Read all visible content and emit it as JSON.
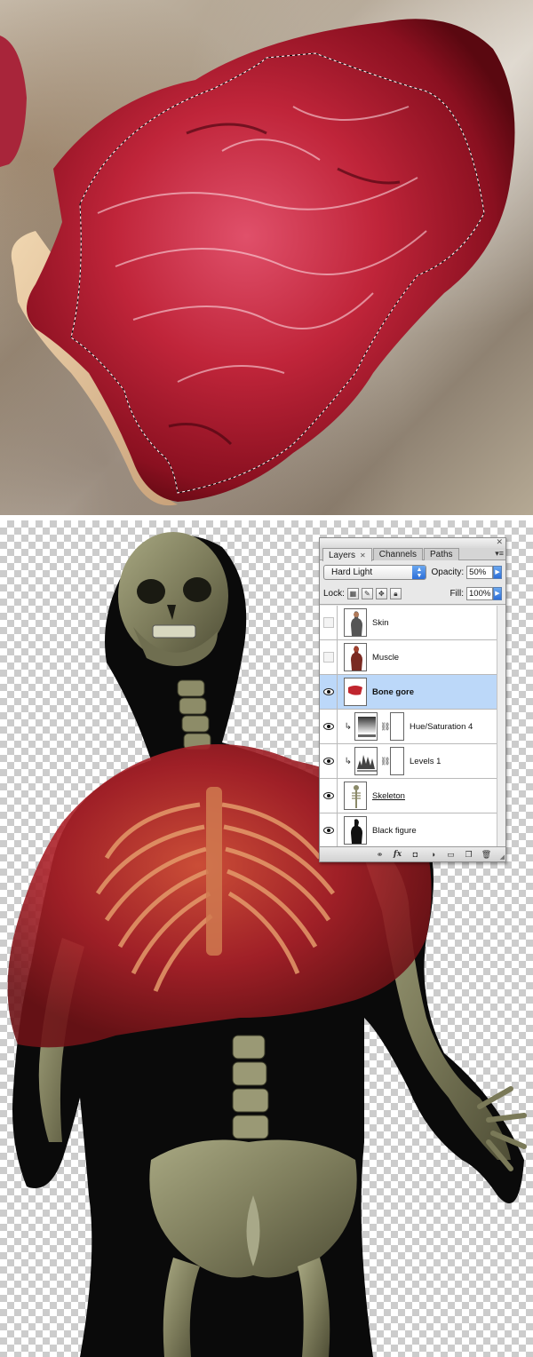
{
  "palette": {
    "tabs": [
      {
        "label": "Layers",
        "active": true
      },
      {
        "label": "Channels",
        "active": false
      },
      {
        "label": "Paths",
        "active": false
      }
    ],
    "blend_mode": "Hard Light",
    "opacity_label": "Opacity:",
    "opacity_value": "50%",
    "lock_label": "Lock:",
    "fill_label": "Fill:",
    "fill_value": "100%",
    "layers": [
      {
        "name": "Skin",
        "visible": false,
        "selected": false,
        "thumb": "figure-skin"
      },
      {
        "name": "Muscle",
        "visible": false,
        "selected": false,
        "thumb": "figure-muscle"
      },
      {
        "name": "Bone gore",
        "visible": true,
        "selected": true,
        "thumb": "figure-gore"
      },
      {
        "name": "Hue/Saturation 4",
        "visible": true,
        "selected": false,
        "type": "adjustment-hue-saturation",
        "clipped": true
      },
      {
        "name": "Levels 1",
        "visible": true,
        "selected": false,
        "type": "adjustment-levels",
        "clipped": true
      },
      {
        "name": "Skeleton",
        "visible": true,
        "selected": false,
        "thumb": "figure-skeleton"
      },
      {
        "name": "Black figure",
        "visible": true,
        "selected": false,
        "thumb": "figure-black"
      }
    ],
    "bottom_buttons": [
      "link-icon",
      "fx-icon",
      "mask-icon",
      "adjustment-icon",
      "folder-icon",
      "new-layer-icon",
      "trash-icon"
    ]
  },
  "colors": {
    "selection_highlight": "#bcd8f9",
    "meat_red": "#b8202e",
    "bone": "#8f8e6a",
    "figure_black": "#0a0a0a",
    "checker": "#cccccc"
  }
}
